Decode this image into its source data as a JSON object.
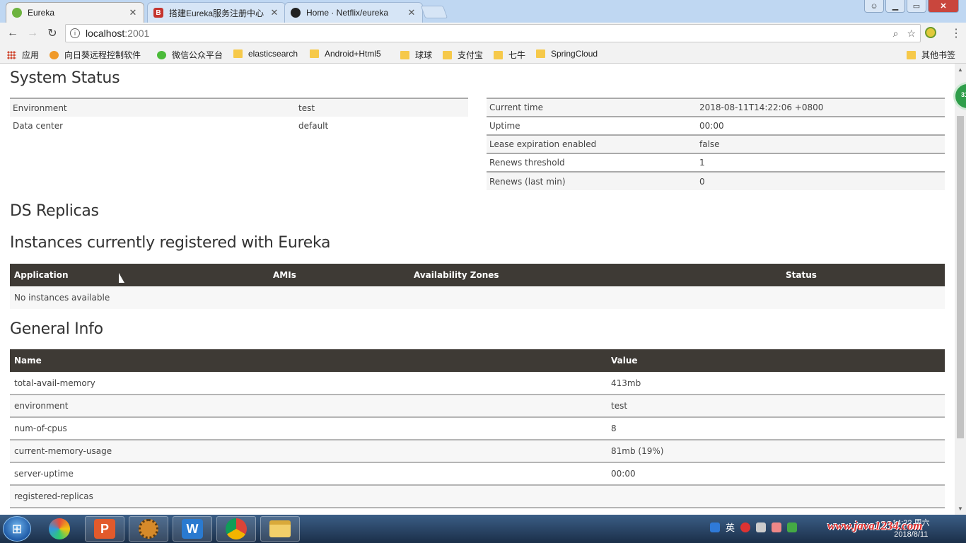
{
  "browser": {
    "tabs": [
      {
        "label": "Eureka",
        "icon": "leaf-icon",
        "active": true
      },
      {
        "label": "搭建Eureka服务注册中心",
        "icon": "b-icon",
        "active": false
      },
      {
        "label": "Home · Netflix/eureka",
        "icon": "github-icon",
        "active": false
      }
    ],
    "close_glyph": "✕",
    "url_host": "localhost",
    "url_port": ":2001",
    "bookmarks": [
      {
        "label": "应用",
        "icon": "apps-icon"
      },
      {
        "label": "向日葵远程控制软件",
        "icon": "sunflower-icon"
      },
      {
        "label": "微信公众平台",
        "icon": "wechat-icon"
      },
      {
        "label": "elasticsearch",
        "icon": "folder-icon"
      },
      {
        "label": "Android+Html5",
        "icon": "folder-icon"
      },
      {
        "label": "球球",
        "icon": "folder-icon"
      },
      {
        "label": "支付宝",
        "icon": "folder-icon"
      },
      {
        "label": "七牛",
        "icon": "folder-icon"
      },
      {
        "label": "SpringCloud",
        "icon": "folder-icon"
      },
      {
        "label": "其他书签",
        "icon": "folder-icon"
      }
    ]
  },
  "eureka": {
    "system_status_title": "System Status",
    "env_table": [
      {
        "key": "Environment",
        "value": "test"
      },
      {
        "key": "Data center",
        "value": "default"
      }
    ],
    "status_table": [
      {
        "key": "Current time",
        "value": "2018-08-11T14:22:06 +0800"
      },
      {
        "key": "Uptime",
        "value": "00:00"
      },
      {
        "key": "Lease expiration enabled",
        "value": "false"
      },
      {
        "key": "Renews threshold",
        "value": "1"
      },
      {
        "key": "Renews (last min)",
        "value": "0"
      }
    ],
    "ds_replicas_title": "DS Replicas",
    "instances_title": "Instances currently registered with Eureka",
    "instances_headers": [
      "Application",
      "AMIs",
      "Availability Zones",
      "Status"
    ],
    "instances_empty": "No instances available",
    "general_info_title": "General Info",
    "general_headers": [
      "Name",
      "Value"
    ],
    "general_rows": [
      {
        "name": "total-avail-memory",
        "value": "413mb"
      },
      {
        "name": "environment",
        "value": "test"
      },
      {
        "name": "num-of-cpus",
        "value": "8"
      },
      {
        "name": "current-memory-usage",
        "value": "81mb (19%)"
      },
      {
        "name": "server-uptime",
        "value": "00:00"
      },
      {
        "name": "registered-replicas",
        "value": ""
      }
    ]
  },
  "side_badge": "31",
  "taskbar": {
    "ime": "英",
    "clock_time": "14:22 周六",
    "clock_date": "2018/8/11",
    "watermark": "www.java1234.com"
  }
}
